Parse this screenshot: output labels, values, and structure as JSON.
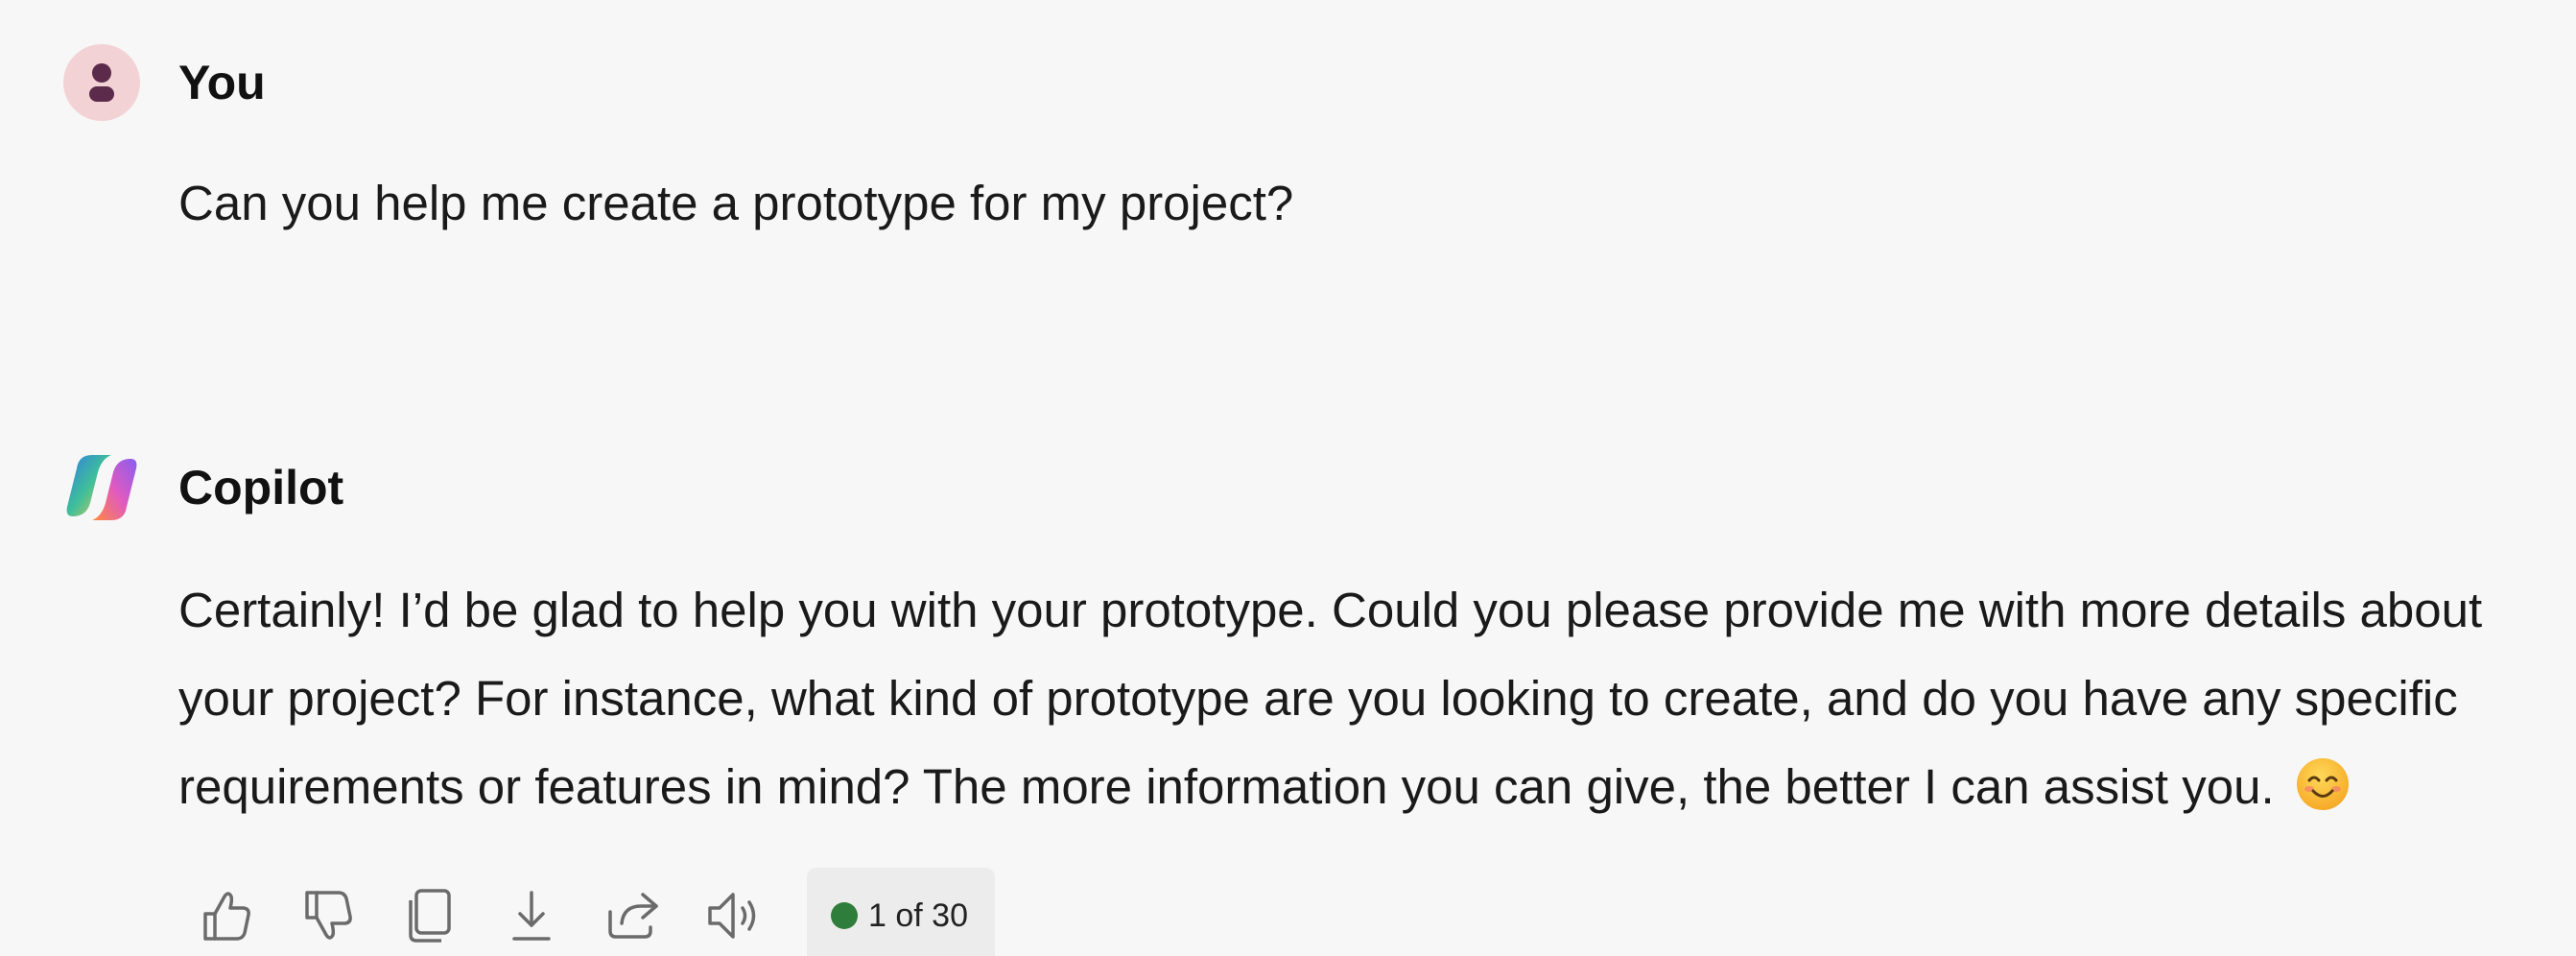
{
  "conversation": {
    "user_message": {
      "sender": "You",
      "text": "Can you help me create a prototype for my project?"
    },
    "copilot_message": {
      "sender": "Copilot",
      "lines": [
        "Certainly! I’d be glad to help you with your prototype. Could you please provide me with more details about",
        "your project? For instance, what kind of prototype are you looking to create, and do you have any specific",
        "requirements or features in mind? The more information you can give, the better I can assist you."
      ],
      "emoji": "smiling-face-emoji"
    }
  },
  "toolbar": {
    "icons": [
      "thumbs-up-icon",
      "thumbs-down-icon",
      "copy-icon",
      "download-icon",
      "share-icon",
      "read-aloud-icon"
    ],
    "page_indicator": {
      "label": "1 of 30",
      "status_color": "#2e7d3a"
    }
  },
  "colors": {
    "background": "#f7f7f7",
    "user_avatar_bg": "#f3d2d6",
    "user_avatar_fg": "#5c2a4a",
    "text": "#1a1a1a",
    "icon": "#6b6b6b"
  }
}
